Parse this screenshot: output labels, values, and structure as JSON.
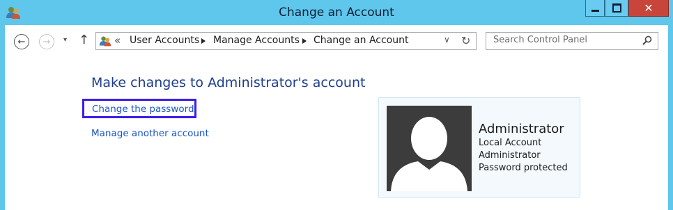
{
  "window": {
    "title": "Change an Account",
    "close_glyph": "✕"
  },
  "navigation": {
    "back_glyph": "←",
    "forward_glyph": "→",
    "recent_glyph": "▾",
    "up_glyph": "↑"
  },
  "address": {
    "overflow_glyph": "«",
    "breadcrumbs": [
      "User Accounts",
      "Manage Accounts",
      "Change an Account"
    ],
    "dropdown_glyph": "∨",
    "refresh_glyph": "↻"
  },
  "search": {
    "placeholder": "Search Control Panel"
  },
  "main": {
    "heading": "Make changes to Administrator's account",
    "links": {
      "change_password": "Change the password",
      "manage_another": "Manage another account"
    }
  },
  "account": {
    "name": "Administrator",
    "type": "Local Account",
    "role": "Administrator",
    "password_status": "Password protected"
  },
  "colors": {
    "title_bar": "#5fc6ec",
    "close_button": "#c7453a",
    "heading": "#1e3d8f",
    "link": "#1a56c9",
    "highlight_box": "#3b1ee6",
    "avatar_bg": "#3c3c3c"
  },
  "icons": {
    "app": "user-accounts-icon",
    "address": "user-accounts-icon",
    "search": "search-icon",
    "avatar": "user-silhouette-icon"
  }
}
